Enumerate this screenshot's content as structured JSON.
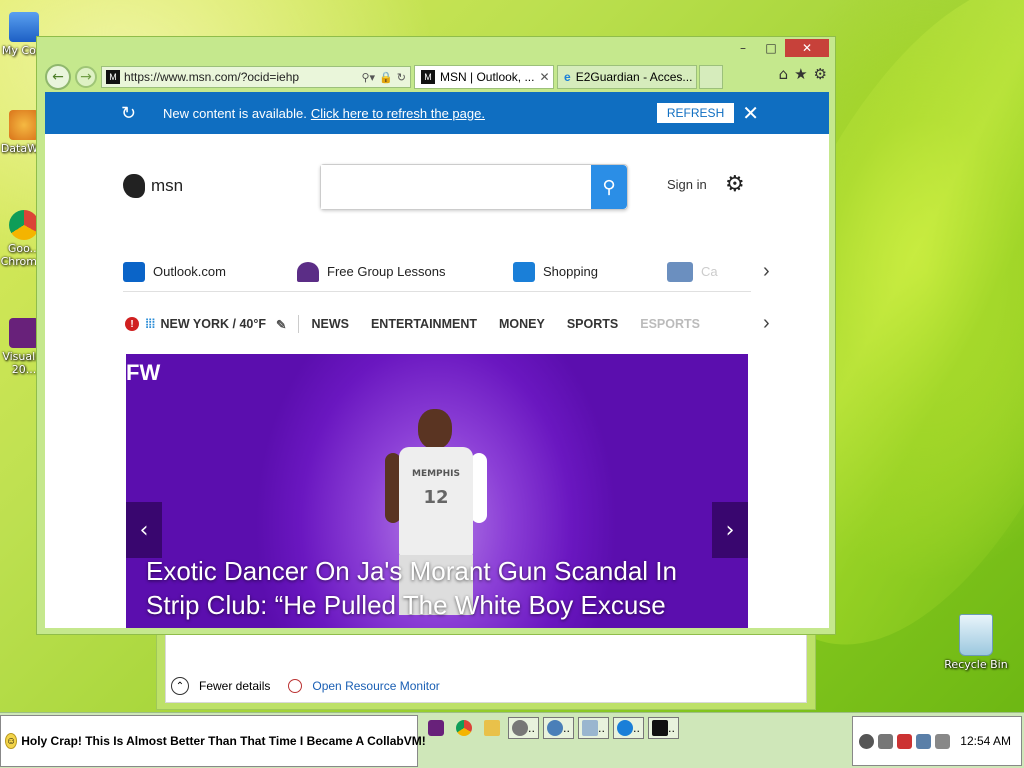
{
  "desktop": {
    "icons": [
      {
        "label": "My Co..."
      },
      {
        "label": "DataW..."
      },
      {
        "label": "Goo...\nChrom..."
      },
      {
        "label": "Visual...\n20..."
      },
      {
        "label": "Recycle Bin"
      }
    ]
  },
  "back_window": {
    "fewer_details": "Fewer details",
    "open_resource_monitor": "Open Resource Monitor"
  },
  "browser": {
    "address": {
      "url": "https://www.msn.com/?ocid=iehp"
    },
    "tabs": [
      {
        "label": "MSN | Outlook, ...",
        "active": true
      },
      {
        "label": "E2Guardian - Acces...",
        "active": false
      }
    ],
    "notification": {
      "message": "New content is available.",
      "link": "Click here to refresh the page.",
      "refresh_label": "REFRESH"
    },
    "msn": {
      "logo_text": "msn",
      "search_placeholder": "",
      "sign_in": "Sign in",
      "quick_links": [
        {
          "label": "Outlook.com",
          "color": "#0a64c8"
        },
        {
          "label": "Free Group Lessons",
          "color": "#5b2d86"
        },
        {
          "label": "Shopping",
          "color": "#1a7fd8"
        },
        {
          "label": "Ca",
          "color": "#6b8fbf"
        }
      ],
      "weather": "NEW YORK / 40°F",
      "categories": [
        "NEWS",
        "ENTERTAINMENT",
        "MONEY",
        "SPORTS",
        "ESPORTS"
      ],
      "hero": {
        "brand": "FW",
        "jersey_text": "MEMPHIS",
        "jersey_number": "12",
        "headline": "Exotic Dancer On Ja's Morant Gun Scandal In Strip Club: “He Pulled The White Boy Excuse"
      }
    }
  },
  "taskbar": {
    "start_text": "Holy Crap! This Is Almost Better Than That Time I Became A CollabVM!",
    "clock": "12:54 AM"
  },
  "colors": {
    "accent": "#0f6ec1",
    "hero_purple": "#6a17c0",
    "close_red": "#c7413a"
  }
}
